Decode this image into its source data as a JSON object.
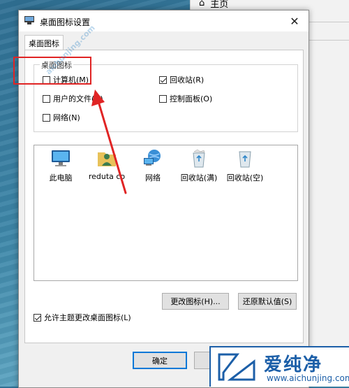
{
  "background_window": {
    "home_label": "主页"
  },
  "dialog": {
    "title": "桌面图标设置",
    "close_glyph": "✕",
    "tab_label": "桌面图标",
    "group_label": "桌面图标",
    "checkboxes": [
      {
        "label": "计算机(M)",
        "checked": false
      },
      {
        "label": "回收站(R)",
        "checked": true
      },
      {
        "label": "用户的文件(U)",
        "checked": false
      },
      {
        "label": "控制面板(O)",
        "checked": false
      },
      {
        "label": "网络(N)",
        "checked": false
      }
    ],
    "icons": [
      {
        "label": "此电脑",
        "icon": "computer-icon"
      },
      {
        "label": "reduta co",
        "icon": "user-folder-icon"
      },
      {
        "label": "网络",
        "icon": "network-icon"
      },
      {
        "label": "回收站(满)",
        "icon": "recycle-bin-full-icon"
      },
      {
        "label": "回收站(空)",
        "icon": "recycle-bin-empty-icon"
      }
    ],
    "change_icon_button": "更改图标(H)...",
    "restore_default_button": "还原默认值(S)",
    "allow_themes": {
      "label": "允许主题更改桌面图标(L)",
      "checked": true
    },
    "ok_button": "确定"
  },
  "watermark": {
    "diagonal_text": "aichunjing.com",
    "brand_name": "爱纯净",
    "brand_url": "www.aichunjing.com"
  },
  "colors": {
    "highlight": "#e02424",
    "brand": "#1c5fa8",
    "accent": "#0078d7"
  }
}
